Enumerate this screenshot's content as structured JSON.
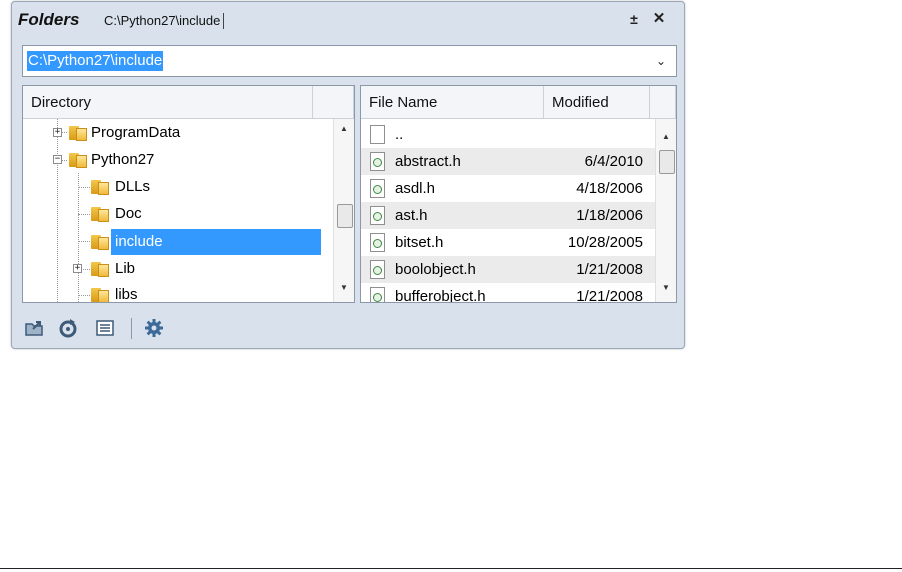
{
  "panel": {
    "title": "Folders",
    "title_path": "C:\\Python27\\include",
    "pin_glyph": "±",
    "close_glyph": "✕",
    "pin_icon": "pin-icon",
    "close_icon": "close-icon"
  },
  "pathbar": {
    "value": "C:\\Python27\\include",
    "dropdown_glyph": "⌄"
  },
  "directory": {
    "header": "Directory",
    "items": [
      {
        "label": "ProgramData",
        "expander": "+"
      },
      {
        "label": "Python27",
        "expander": "−"
      },
      {
        "label": "DLLs"
      },
      {
        "label": "Doc"
      },
      {
        "label": "include",
        "selected": true
      },
      {
        "label": "Lib",
        "expander": "+"
      },
      {
        "label": "libs"
      }
    ]
  },
  "files": {
    "headers": [
      "File Name",
      "Modified"
    ],
    "rows": [
      {
        "name": "..",
        "modified": ""
      },
      {
        "name": "abstract.h",
        "modified": "6/4/2010"
      },
      {
        "name": "asdl.h",
        "modified": "4/18/2006"
      },
      {
        "name": "ast.h",
        "modified": "1/18/2006"
      },
      {
        "name": "bitset.h",
        "modified": "10/28/2005"
      },
      {
        "name": "boolobject.h",
        "modified": "1/21/2008"
      },
      {
        "name": "bufferobject.h",
        "modified": "1/21/2008"
      }
    ]
  },
  "toolbar": {
    "icons": [
      "open-folder-icon",
      "refresh-icon",
      "details-view-icon",
      "settings-gear-icon"
    ]
  },
  "colors": {
    "selection": "#3399ff",
    "panel_bg": "#d9e2ec",
    "folder_yellow": "#f0b93a"
  }
}
